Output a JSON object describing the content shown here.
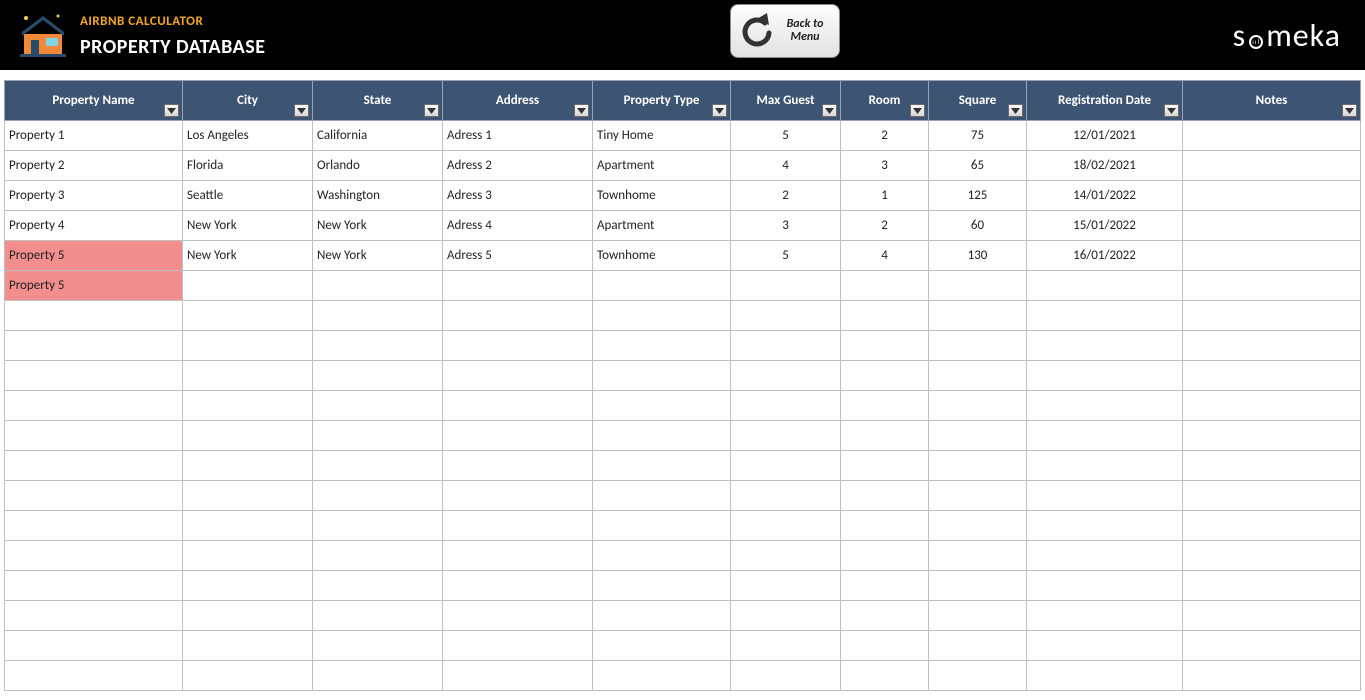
{
  "header": {
    "app_title": "AIRBNB CALCULATOR",
    "page_title": "PROPERTY DATABASE",
    "back_button": "Back to Menu",
    "brand": "someka"
  },
  "columns": [
    {
      "key": "property_name",
      "label": "Property Name",
      "align": "left"
    },
    {
      "key": "city",
      "label": "City",
      "align": "left"
    },
    {
      "key": "state",
      "label": "State",
      "align": "left"
    },
    {
      "key": "address",
      "label": "Address",
      "align": "left"
    },
    {
      "key": "property_type",
      "label": "Property Type",
      "align": "left"
    },
    {
      "key": "max_guest",
      "label": "Max Guest",
      "align": "center"
    },
    {
      "key": "room",
      "label": "Room",
      "align": "center"
    },
    {
      "key": "square",
      "label": "Square",
      "align": "center"
    },
    {
      "key": "registration_date",
      "label": "Registration Date",
      "align": "center"
    },
    {
      "key": "notes",
      "label": "Notes",
      "align": "left"
    }
  ],
  "rows": [
    {
      "property_name": "Property 1",
      "city": "Los Angeles",
      "state": "California",
      "address": "Adress 1",
      "property_type": "Tiny Home",
      "max_guest": "5",
      "room": "2",
      "square": "75",
      "registration_date": "12/01/2021",
      "notes": "",
      "highlight": false
    },
    {
      "property_name": "Property 2",
      "city": "Florida",
      "state": "Orlando",
      "address": "Adress 2",
      "property_type": "Apartment",
      "max_guest": "4",
      "room": "3",
      "square": "65",
      "registration_date": "18/02/2021",
      "notes": "",
      "highlight": false
    },
    {
      "property_name": "Property 3",
      "city": "Seattle",
      "state": "Washington",
      "address": "Adress 3",
      "property_type": "Townhome",
      "max_guest": "2",
      "room": "1",
      "square": "125",
      "registration_date": "14/01/2022",
      "notes": "",
      "highlight": false
    },
    {
      "property_name": "Property 4",
      "city": "New York",
      "state": "New York",
      "address": "Adress 4",
      "property_type": "Apartment",
      "max_guest": "3",
      "room": "2",
      "square": "60",
      "registration_date": "15/01/2022",
      "notes": "",
      "highlight": false
    },
    {
      "property_name": "Property 5",
      "city": "New York",
      "state": "New York",
      "address": "Adress 5",
      "property_type": "Townhome",
      "max_guest": "5",
      "room": "4",
      "square": "130",
      "registration_date": "16/01/2022",
      "notes": "",
      "highlight": true
    },
    {
      "property_name": "Property 5",
      "city": "",
      "state": "",
      "address": "",
      "property_type": "",
      "max_guest": "",
      "room": "",
      "square": "",
      "registration_date": "",
      "notes": "",
      "highlight": true
    }
  ],
  "empty_rows": 13
}
